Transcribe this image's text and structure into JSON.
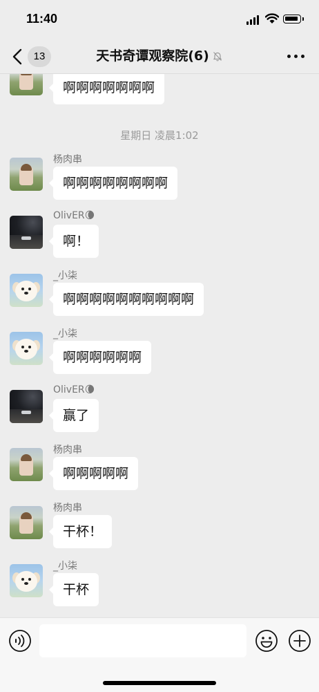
{
  "status_bar": {
    "time": "11:40"
  },
  "nav": {
    "unread_count": "13",
    "title": "天书奇谭观察院(6)"
  },
  "messages": [
    {
      "sender": "",
      "avatar": "park",
      "text": "啊啊啊啊啊啊啊"
    },
    {
      "sender": "杨肉串",
      "avatar": "park",
      "text": "啊啊啊啊啊啊啊啊"
    },
    {
      "sender": "OlivER🌘",
      "avatar": "dark",
      "text": "啊！"
    },
    {
      "sender": "_小柒",
      "avatar": "dog",
      "text": "啊啊啊啊啊啊啊啊啊啊"
    },
    {
      "sender": "_小柒",
      "avatar": "dog",
      "text": "啊啊啊啊啊啊"
    },
    {
      "sender": "OlivER🌘",
      "avatar": "dark",
      "text": "赢了"
    },
    {
      "sender": "杨肉串",
      "avatar": "park",
      "text": "啊啊啊啊啊"
    },
    {
      "sender": "杨肉串",
      "avatar": "park",
      "text": "干杯！"
    },
    {
      "sender": "_小柒",
      "avatar": "dog",
      "text": "干杯"
    }
  ],
  "timestamp": "星期日 凌晨1:02",
  "input": {
    "placeholder": "",
    "value": ""
  },
  "icons": {
    "back": "chevron-left-icon",
    "mute": "bell-slash-icon",
    "more": "more-dots-icon",
    "voice": "voice-icon",
    "emoji": "emoji-icon",
    "plus": "plus-icon"
  }
}
